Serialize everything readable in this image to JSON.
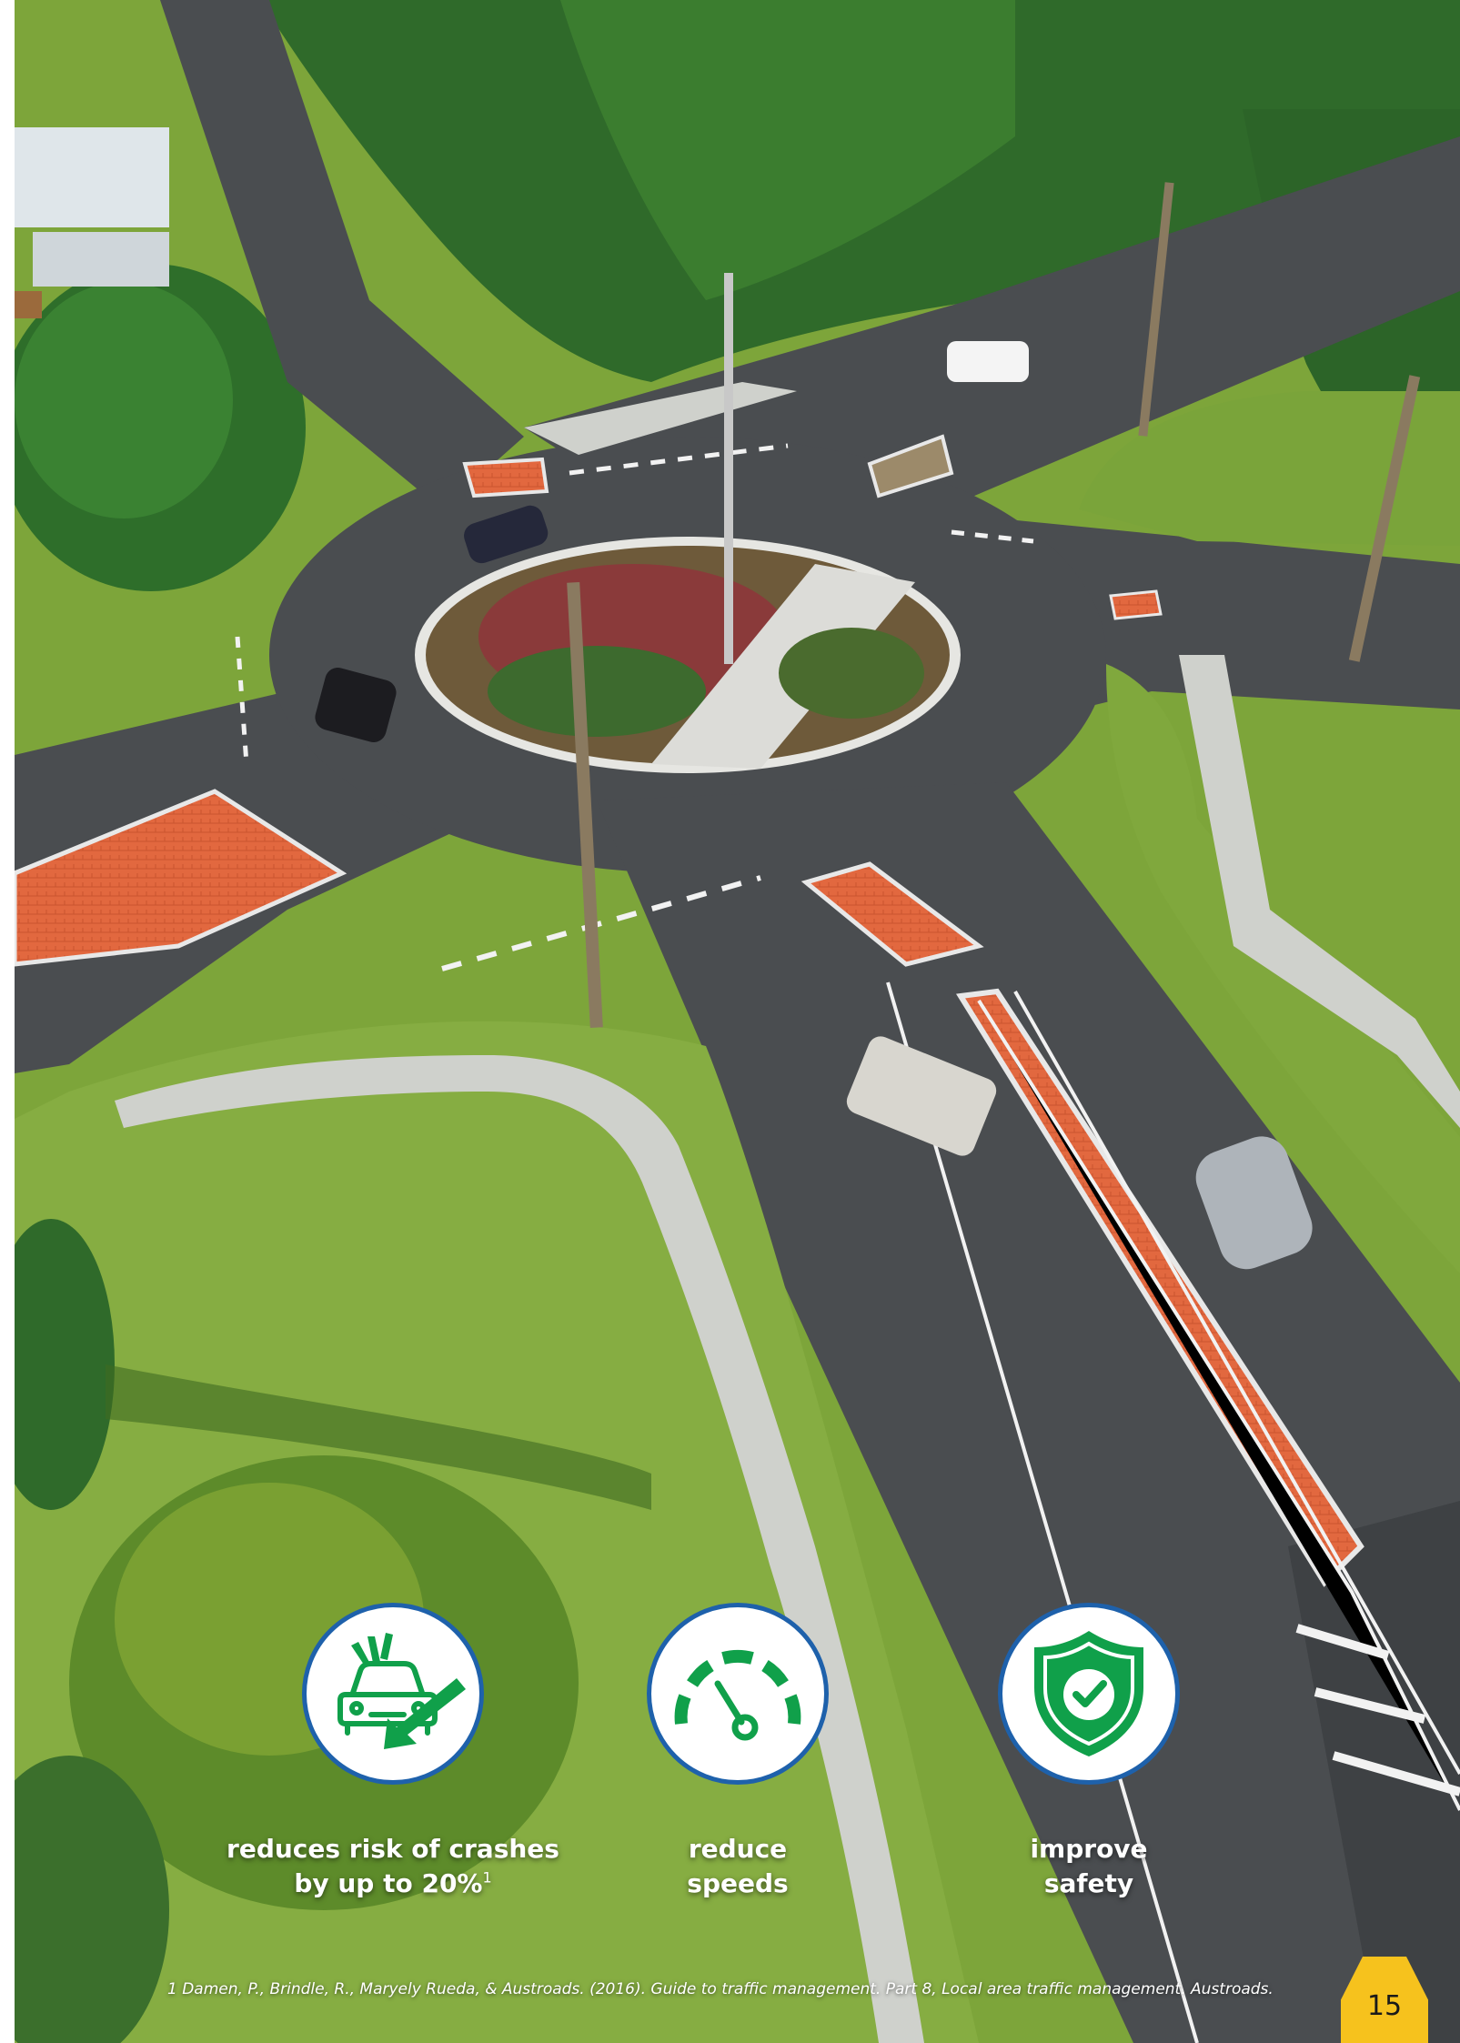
{
  "features": [
    {
      "icon": "car-crash-reduction-icon",
      "line1": "reduces risk of crashes",
      "line2": "by up to 20%",
      "footnote_ref": "1"
    },
    {
      "icon": "speedometer-icon",
      "line1": "reduce",
      "line2": "speeds"
    },
    {
      "icon": "shield-check-icon",
      "line1": "improve",
      "line2": "safety"
    }
  ],
  "footnote": "1 Damen, P., Brindle, R., Maryely Rueda, & Austroads. (2016). Guide to traffic management. Part 8, Local area traffic management. Austroads.",
  "page_number": "15",
  "colors": {
    "icon_green": "#10a04a",
    "circle_border": "#1e61ab",
    "page_tab": "#f6c21d",
    "median_brick": "#e2683f",
    "road": "#4a4d50",
    "grass": "#7da53a",
    "foliage": "#2f6a2a"
  }
}
